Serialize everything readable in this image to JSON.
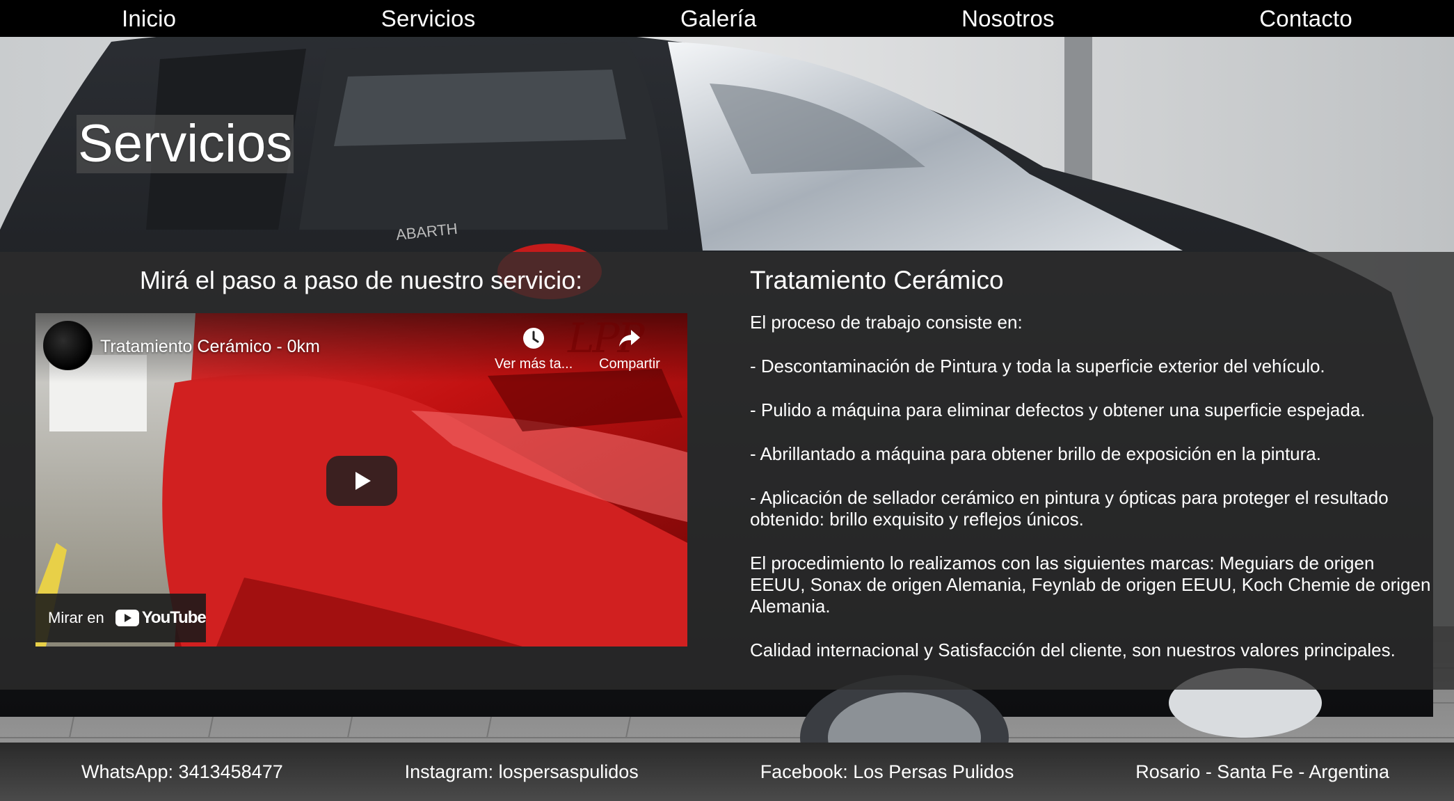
{
  "nav": {
    "items": [
      "Inicio",
      "Servicios",
      "Galería",
      "Nosotros",
      "Contacto"
    ]
  },
  "hero": {
    "title": "Servicios"
  },
  "video_section": {
    "heading": "Mirá el paso a paso de nuestro servicio:",
    "video": {
      "title": "Tratamiento Cerámico - 0km",
      "watch_later_label": "Ver más ta...",
      "share_label": "Compartir",
      "watch_on_label": "Mirar en",
      "youtube_label": "YouTube",
      "watermark": "LPP",
      "icons": [
        "clock-icon",
        "share-icon",
        "play-icon",
        "youtube-logo-icon"
      ]
    }
  },
  "service": {
    "title": "Tratamiento Cerámico",
    "intro": "El proceso de trabajo consiste en:",
    "steps": [
      "- Descontaminación de Pintura y toda la superficie exterior del vehículo.",
      "- Pulido a máquina para eliminar defectos y obtener una superficie espejada.",
      "- Abrillantado a máquina para obtener brillo de exposición en la pintura.",
      "- Aplicación de sellador cerámico en pintura y ópticas para proteger el resultado obtenido: brillo exquisito y reflejos únicos."
    ],
    "brands": "El procedimiento lo realizamos con las siguientes marcas: Meguiars de origen EEUU, Sonax de origen Alemania, Feynlab de origen EEUU, Koch Chemie de origen Alemania.",
    "closing": "Calidad internacional y Satisfacción del cliente, son nuestros valores principales."
  },
  "footer": {
    "whatsapp": "WhatsApp: 3413458477",
    "instagram": "Instagram: lospersaspulidos",
    "facebook": "Facebook: Los Persas Pulidos",
    "location": "Rosario - Santa Fe - Argentina"
  },
  "colors": {
    "nav_bg": "#000000",
    "panel_bg": "#2d2d2d",
    "text": "#ffffff",
    "video_red": "#c41414"
  }
}
